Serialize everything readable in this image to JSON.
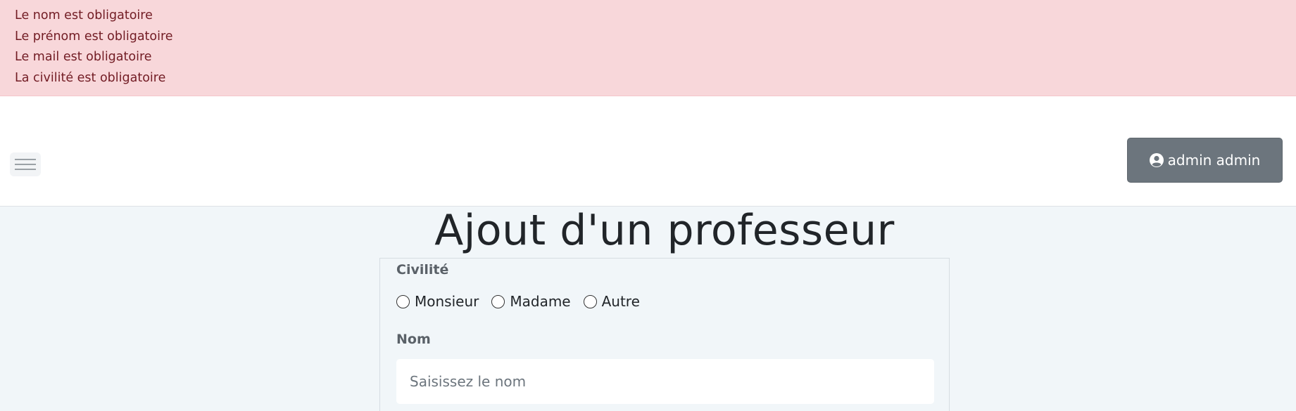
{
  "alert": {
    "messages": [
      "Le nom est obligatoire",
      "Le prénom est obligatoire",
      "Le mail est obligatoire",
      "La civilité est obligatoire"
    ]
  },
  "header": {
    "menu_icon": "hamburger-menu-icon",
    "user": {
      "icon": "user-circle-icon",
      "label": "admin admin"
    }
  },
  "page": {
    "title": "Ajout d'un professeur"
  },
  "form": {
    "civilite": {
      "label": "Civilité",
      "options": [
        "Monsieur",
        "Madame",
        "Autre"
      ]
    },
    "nom": {
      "label": "Nom",
      "value": "",
      "placeholder": "Saisissez le nom"
    }
  },
  "colors": {
    "alert_bg": "#f8d7da",
    "alert_text": "#721c24",
    "user_button": "#6c757d",
    "page_bg": "#f1f6f9"
  }
}
